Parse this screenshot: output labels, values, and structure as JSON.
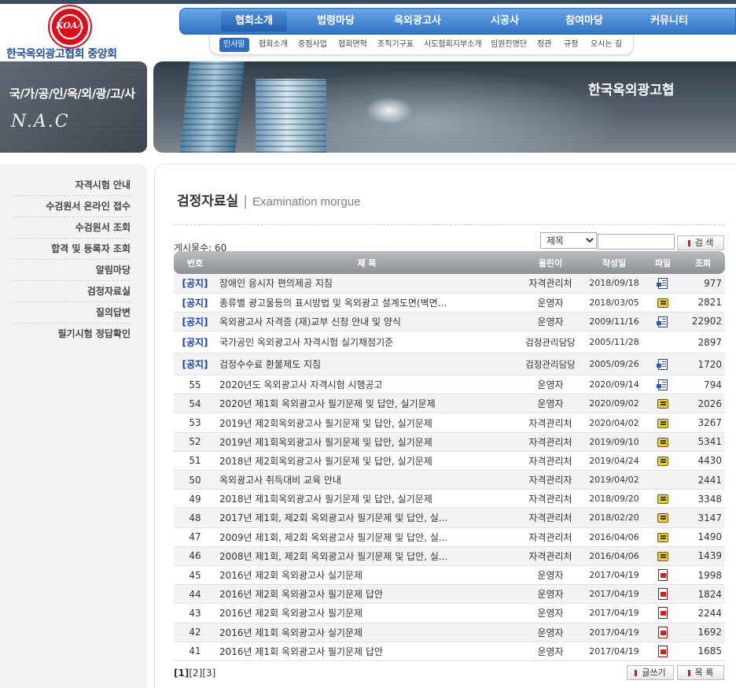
{
  "logo": {
    "emblem_text": "KOAA",
    "org_name": "한국옥외광고협회 중앙회"
  },
  "main_nav": [
    {
      "label": "협회소개",
      "active": true
    },
    {
      "label": "법령마당"
    },
    {
      "label": "옥외광고사"
    },
    {
      "label": "시공사"
    },
    {
      "label": "참여마당"
    },
    {
      "label": "커뮤니티"
    }
  ],
  "sub_nav": [
    {
      "label": "인사말",
      "active": true
    },
    {
      "label": "협회소개"
    },
    {
      "label": "중점사업"
    },
    {
      "label": "협회연혁"
    },
    {
      "label": "조직기구표"
    },
    {
      "label": "시도협회지부소개"
    },
    {
      "label": "임원진명단"
    },
    {
      "label": "정관"
    },
    {
      "label": "규정"
    },
    {
      "label": "오시는 길"
    }
  ],
  "banner": {
    "slogan": "국/가/공/인/옥/외/광/고/사",
    "nac": "N.A.C",
    "title": "한국옥외광고협"
  },
  "sidebar": [
    "자격시험 안내",
    "수검원서 온라인 접수",
    "수검원서 조회",
    "합격 및 등록자 조회",
    "알림마당",
    "검정자료실",
    "질의답변",
    "필기시험 정답확인"
  ],
  "page": {
    "title": "검정자료실",
    "subtitle": "Examination morgue"
  },
  "board": {
    "count_label": "게시물수: 60",
    "search": {
      "option": "제목",
      "button": "검 색"
    },
    "columns": {
      "no": "번호",
      "title": "제 목",
      "writer": "올린이",
      "date": "작성일",
      "file": "파일",
      "hits": "조회"
    },
    "rows": [
      {
        "no": "[공지]",
        "title": "장애인 응시자 편의제공 지침",
        "writer": "자격관리처",
        "date": "2018/09/18",
        "file": "doc",
        "hits": "977"
      },
      {
        "no": "[공지]",
        "title": "종류별 광고물등의 표시방법 및 옥외광고 설계도면(벽면...",
        "writer": "운영자",
        "date": "2018/03/05",
        "file": "hwp",
        "hits": "2821"
      },
      {
        "no": "[공지]",
        "title": "옥외광고사 자격증 (재)교부 신청 안내 및 양식",
        "writer": "운영자",
        "date": "2009/11/16",
        "file": "doc",
        "hits": "22902"
      },
      {
        "no": "[공지]",
        "title": "국가공인 옥외광고사 자격시험 실기채점기준",
        "writer": "검정관리담당",
        "date": "2005/11/28",
        "file": "",
        "hits": "2897"
      },
      {
        "no": "[공지]",
        "title": "검정수수료 환불제도 지침",
        "writer": "검정관리담당",
        "date": "2005/09/26",
        "file": "doc",
        "hits": "1720"
      },
      {
        "no": "55",
        "title": "2020년도 옥외광고사 자격시험 시행공고",
        "writer": "운영자",
        "date": "2020/09/14",
        "file": "doc",
        "hits": "794"
      },
      {
        "no": "54",
        "title": "2020년 제1회 옥외광고사 필기문제 및 답안, 실기문제",
        "writer": "운영자",
        "date": "2020/09/02",
        "file": "hwp",
        "hits": "2026"
      },
      {
        "no": "53",
        "title": "2019년 제2회옥외광고사 필기문제 및 답안, 실기문제",
        "writer": "자격관리처",
        "date": "2020/04/02",
        "file": "hwp",
        "hits": "3267"
      },
      {
        "no": "52",
        "title": "2019년 제1회옥외광고사 필기문제 및 답안, 실기문제",
        "writer": "자격관리처",
        "date": "2019/09/10",
        "file": "hwp",
        "hits": "5341"
      },
      {
        "no": "51",
        "title": "2018년 제2회옥외광고사 필기문제 및 답안, 실기문제",
        "writer": "자격관리처",
        "date": "2019/04/24",
        "file": "hwp",
        "hits": "4430"
      },
      {
        "no": "50",
        "title": "옥외광고사 취득대비 교육 안내",
        "writer": "자격관리자",
        "date": "2019/04/02",
        "file": "",
        "hits": "2441"
      },
      {
        "no": "49",
        "title": "2018년 제1회옥외광고사 필기문제 및 답안, 실기문제",
        "writer": "자격관리처",
        "date": "2018/09/20",
        "file": "hwp",
        "hits": "3348"
      },
      {
        "no": "48",
        "title": "2017년 제1회, 제2회 옥외광고사 필기문제 및 답안, 실...",
        "writer": "자격관리처",
        "date": "2018/02/20",
        "file": "hwp",
        "hits": "3147"
      },
      {
        "no": "47",
        "title": "2009년 제1회, 제2회 옥외광고사 필기문제 및 답안, 실...",
        "writer": "자격관리처",
        "date": "2016/04/06",
        "file": "hwp",
        "hits": "1490"
      },
      {
        "no": "46",
        "title": "2008년 제1회, 제2회 옥외광고사 필기문제 및 답안, 실...",
        "writer": "자격관리처",
        "date": "2016/04/06",
        "file": "hwp",
        "hits": "1439"
      },
      {
        "no": "45",
        "title": "2016년 제2회 옥외광고사 실기문제",
        "writer": "운영자",
        "date": "2017/04/19",
        "file": "pdf",
        "hits": "1998"
      },
      {
        "no": "44",
        "title": "2016년 제2회 옥외광고사 필기문제 답안",
        "writer": "운영자",
        "date": "2017/04/19",
        "file": "pdf",
        "hits": "1824"
      },
      {
        "no": "43",
        "title": "2016년 제2회 옥외광고사 필기문제",
        "writer": "운영자",
        "date": "2017/04/19",
        "file": "pdf",
        "hits": "2244"
      },
      {
        "no": "42",
        "title": "2016년 제1회 옥외광고사 실기문제",
        "writer": "운영자",
        "date": "2017/04/19",
        "file": "pdf",
        "hits": "1692"
      },
      {
        "no": "41",
        "title": "2016년 제1회 옥외광고사 필기문제 답안",
        "writer": "운영자",
        "date": "2017/04/19",
        "file": "pdf",
        "hits": "1685"
      }
    ]
  },
  "pagination": {
    "current": "[1]",
    "pages": [
      "[2]",
      "[3]"
    ]
  },
  "actions": {
    "write": "글쓰기",
    "list": "목 록"
  }
}
